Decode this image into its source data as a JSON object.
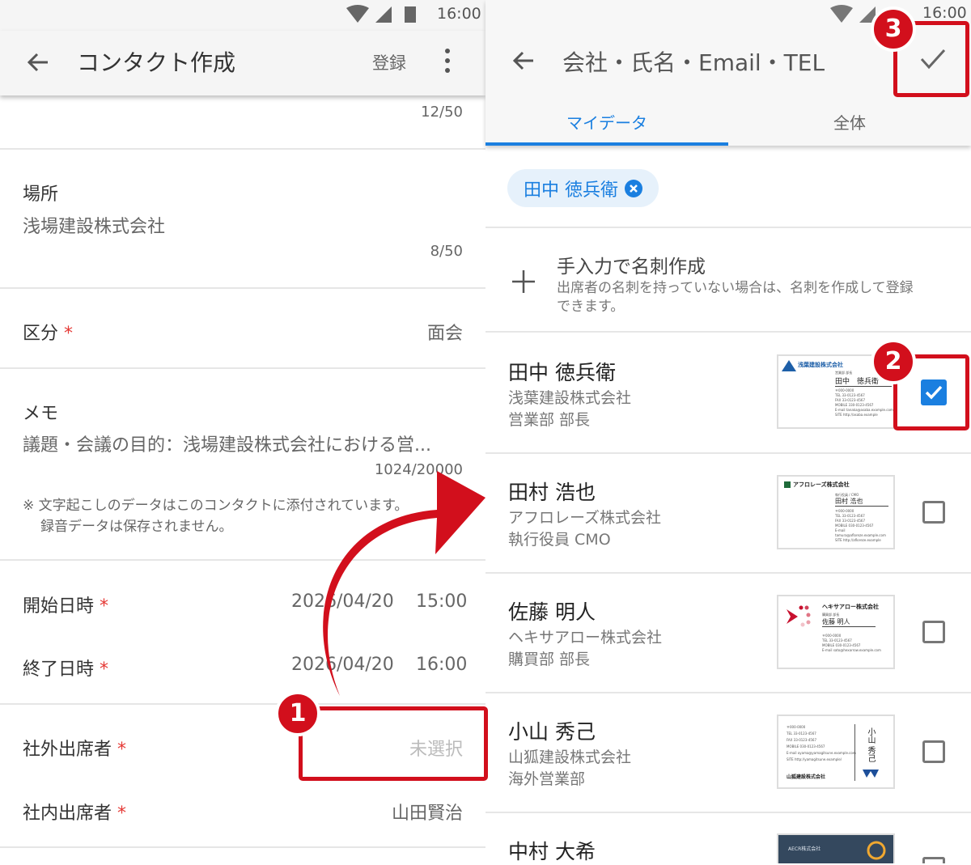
{
  "left": {
    "status_time": "16:00",
    "title": "コンタクト作成",
    "register": "登録",
    "top_count": "12/50",
    "place": {
      "label": "場所",
      "value": "浅場建設株式会社",
      "count": "8/50"
    },
    "category": {
      "label": "区分",
      "value": "面会"
    },
    "memo": {
      "label": "メモ",
      "value": "議題・会議の目的：浅場建設株式会社における営...",
      "count": "1024/20000",
      "note1": "※ 文字起こしのデータはこのコンタクトに添付されています。",
      "note2": "録音データは保存されません。"
    },
    "start": {
      "label": "開始日時",
      "date": "2026/04/20",
      "time": "15:00"
    },
    "end": {
      "label": "終了日時",
      "date": "2026/04/20",
      "time": "16:00"
    },
    "external": {
      "label": "社外出席者",
      "value": "未選択"
    },
    "internal": {
      "label": "社内出席者",
      "value": "山田賢治"
    },
    "required_mark": "*"
  },
  "right": {
    "status_time": "16:00",
    "title": "会社・氏名・Email・TEL",
    "tabs": [
      {
        "label": "マイデータ"
      },
      {
        "label": "全体"
      }
    ],
    "chip": "田中 徳兵衛",
    "manual": {
      "title": "手入力で名刺作成",
      "desc1": "出席者の名刺を持っていない場合は、名刺を作成して登録",
      "desc2": "できます。"
    },
    "contacts": [
      {
        "name": "田中 徳兵衛",
        "company": "浅葉建設株式会社",
        "dept": "営業部 部長",
        "checked": true,
        "card_company": "浅葉建設株式会社",
        "card_name": "田中　徳兵衛",
        "card_title": "営業部 部長",
        "card_lines": [
          "〒000-0000",
          "TEL 33-0123-4567",
          "FAX 33-0123-4567",
          "MOBILE 330-0123-4567",
          "E-mail tanaka@asaba.example.com",
          "SITE http://asaba.example"
        ]
      },
      {
        "name": "田村 浩也",
        "company": "アフロレーズ株式会社",
        "dept": "執行役員 CMO",
        "checked": false,
        "card_company": "アフロレーズ株式会社",
        "card_name": "田村 浩也",
        "card_title": "執行役員 / CMO",
        "card_lines": [
          "〒000-0000",
          "TEL 33-0123-4567",
          "FAX 33-0123-4567",
          "MOBILE 030-0123-4567",
          "E-mail tamura@afloreze.example.com",
          "SITE http://afloreze.example"
        ]
      },
      {
        "name": "佐藤 明人",
        "company": "ヘキサアロー株式会社",
        "dept": "購買部 部長",
        "checked": false,
        "card_company": "ヘキサアロー株式会社",
        "card_name": "佐藤 明人",
        "card_title": "購買部 部長",
        "card_lines": [
          "〒000-0000",
          "TEL 33-0123-4567",
          "MOBILE 030-0123-4567",
          "E-mail sato@hexarrow.example.com"
        ]
      },
      {
        "name": "小山 秀己",
        "company": "山狐建設株式会社",
        "dept": "海外営業部",
        "checked": false,
        "card_company": "山狐建設株式会社",
        "card_name": "小山 秀己",
        "card_lines": [
          "〒000-0000",
          "TEL 33-0123-4567",
          "FAX 33-0123-4567",
          "MOBILE 030-0123-4567",
          "E-mail oyama@yamagitsune.example.com",
          "SITE http://yamagitsune.example/"
        ]
      },
      {
        "name": "中村 大希",
        "checked": false,
        "card_company": "AECR株式会社"
      }
    ]
  },
  "annotations": [
    "1",
    "2",
    "3"
  ],
  "colors": {
    "accent": "#1a7fe0",
    "annotation": "#d20f1c"
  }
}
